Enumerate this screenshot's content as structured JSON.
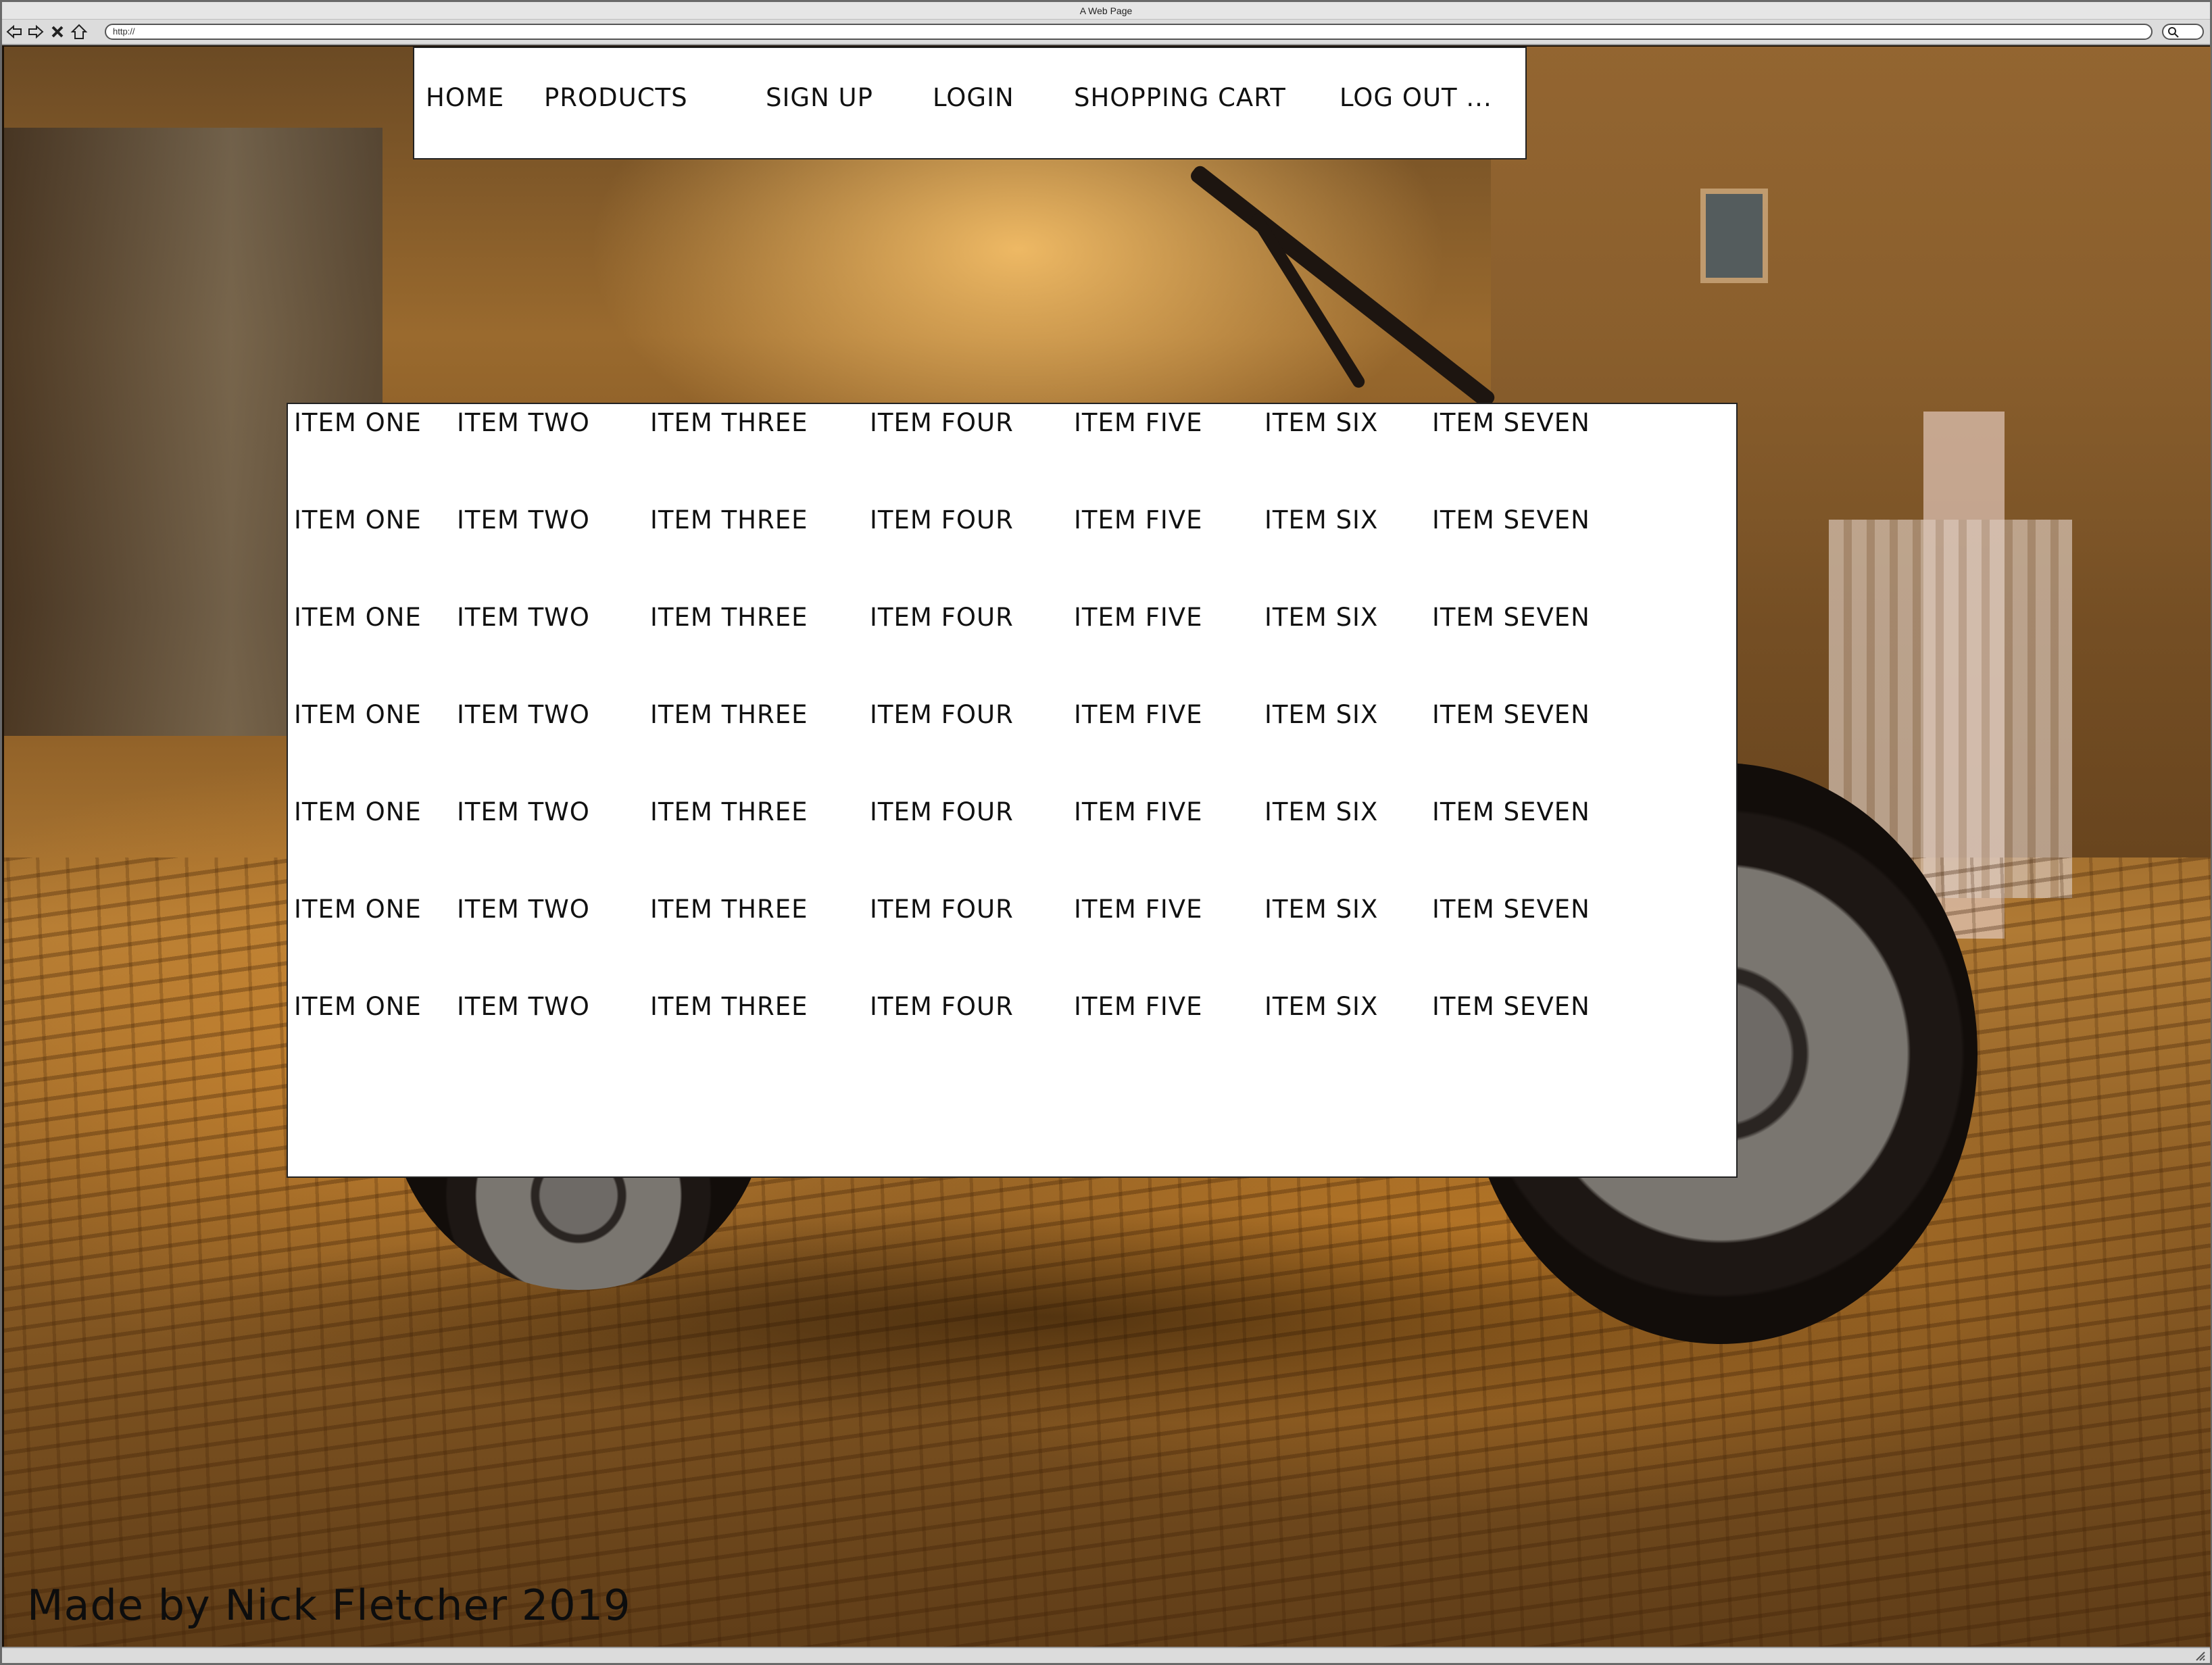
{
  "browser": {
    "window_title": "A Web Page",
    "url": "http://"
  },
  "navbar": {
    "items": [
      {
        "label": "HOME"
      },
      {
        "label": "PRODUCTS"
      },
      {
        "label": "SIGN UP"
      },
      {
        "label": "LOGIN"
      },
      {
        "label": "SHOPPING CART"
      },
      {
        "label": "LOG OUT ..."
      }
    ]
  },
  "products": {
    "rows": [
      [
        "ITEM ONE",
        "ITEM TWO",
        "ITEM THREE",
        "ITEM FOUR",
        "ITEM FIVE",
        "ITEM SIX",
        "ITEM SEVEN"
      ],
      [
        "ITEM ONE",
        "ITEM TWO",
        "ITEM THREE",
        "ITEM FOUR",
        "ITEM FIVE",
        "ITEM SIX",
        "ITEM SEVEN"
      ],
      [
        "ITEM ONE",
        "ITEM TWO",
        "ITEM THREE",
        "ITEM FOUR",
        "ITEM FIVE",
        "ITEM SIX",
        "ITEM SEVEN"
      ],
      [
        "ITEM ONE",
        "ITEM TWO",
        "ITEM THREE",
        "ITEM FOUR",
        "ITEM FIVE",
        "ITEM SIX",
        "ITEM SEVEN"
      ],
      [
        "ITEM ONE",
        "ITEM TWO",
        "ITEM THREE",
        "ITEM FOUR",
        "ITEM FIVE",
        "ITEM SIX",
        "ITEM SEVEN"
      ],
      [
        "ITEM ONE",
        "ITEM TWO",
        "ITEM THREE",
        "ITEM FOUR",
        "ITEM FIVE",
        "ITEM SIX",
        "ITEM SEVEN"
      ],
      [
        "ITEM ONE",
        "ITEM TWO",
        "ITEM THREE",
        "ITEM FOUR",
        "ITEM FIVE",
        "ITEM SIX",
        "ITEM SEVEN"
      ]
    ]
  },
  "footer": {
    "credit": "Made by Nick Fletcher 2019"
  },
  "icons": {
    "back": "back-arrow-icon",
    "forward": "forward-arrow-icon",
    "stop": "close-icon",
    "home": "home-icon",
    "search": "search-icon"
  },
  "colors": {
    "panel_bg": "#ffffff",
    "text": "#111111",
    "background_tone": "#b07a34"
  }
}
